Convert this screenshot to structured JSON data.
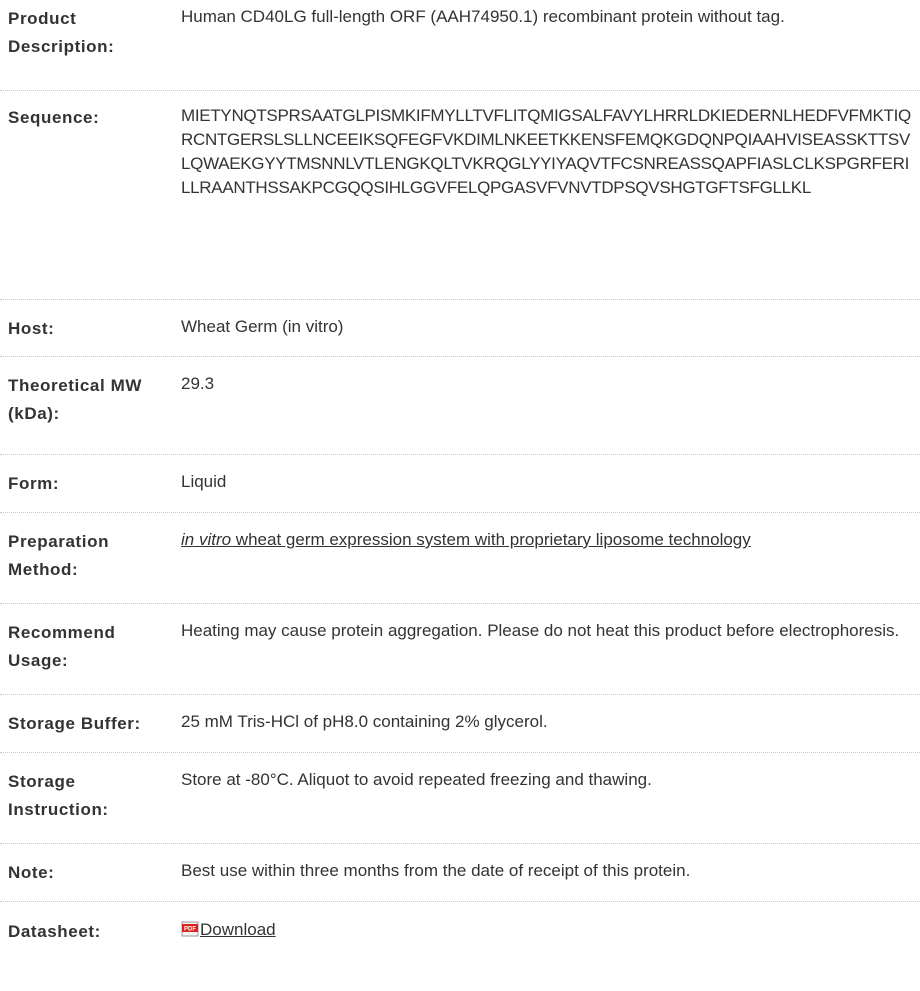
{
  "rows": [
    {
      "label": "Product Description:",
      "value": "Human CD40LG full-length ORF (AAH74950.1) recombinant protein without tag."
    },
    {
      "label": "Sequence:",
      "value": "MIETYNQTSPRSAATGLPISMKIFMYLLTVFLITQMIGSALFAVYLHRRLDKIEDERNLHEDFVFMKTIQRCNTGERSLSLLNCEEIKSQFEGFVKDIMLNKEETKKENSFEMQKGDQNPQIAAHVISEASSKTTSVLQWAEKGYYTMSNNLVTLENGKQLTVKRQGLYYIYAQVTFCSNREASSQAPFIASLCLKSPGRFERILLRAANTHSSAKPCGQQSIHLGGVFELQPGASVFVNVTDPSQVSHGTGFTSFGLLKL"
    },
    {
      "label": "Host:",
      "value": "Wheat Germ (in vitro)"
    },
    {
      "label": "Theoretical MW (kDa):",
      "value": "29.3"
    },
    {
      "label": "Form:",
      "value": "Liquid"
    },
    {
      "label": "Preparation Method:",
      "value_italic": "in vitro",
      "value_rest": " wheat germ expression system with proprietary liposome technology"
    },
    {
      "label": "Recommend Usage:",
      "value": "Heating may cause protein aggregation. Please do not heat this product before electrophoresis."
    },
    {
      "label": "Storage Buffer:",
      "value": "25 mM Tris-HCl of pH8.0 containing 2% glycerol."
    },
    {
      "label": "Storage Instruction:",
      "value": "Store at -80°C. Aliquot to avoid repeated freezing and thawing."
    },
    {
      "label": "Note:",
      "value": "Best use within three months from the date of receipt of this protein."
    },
    {
      "label": "Datasheet:",
      "link_text": "Download",
      "icon": "pdf-icon"
    }
  ]
}
